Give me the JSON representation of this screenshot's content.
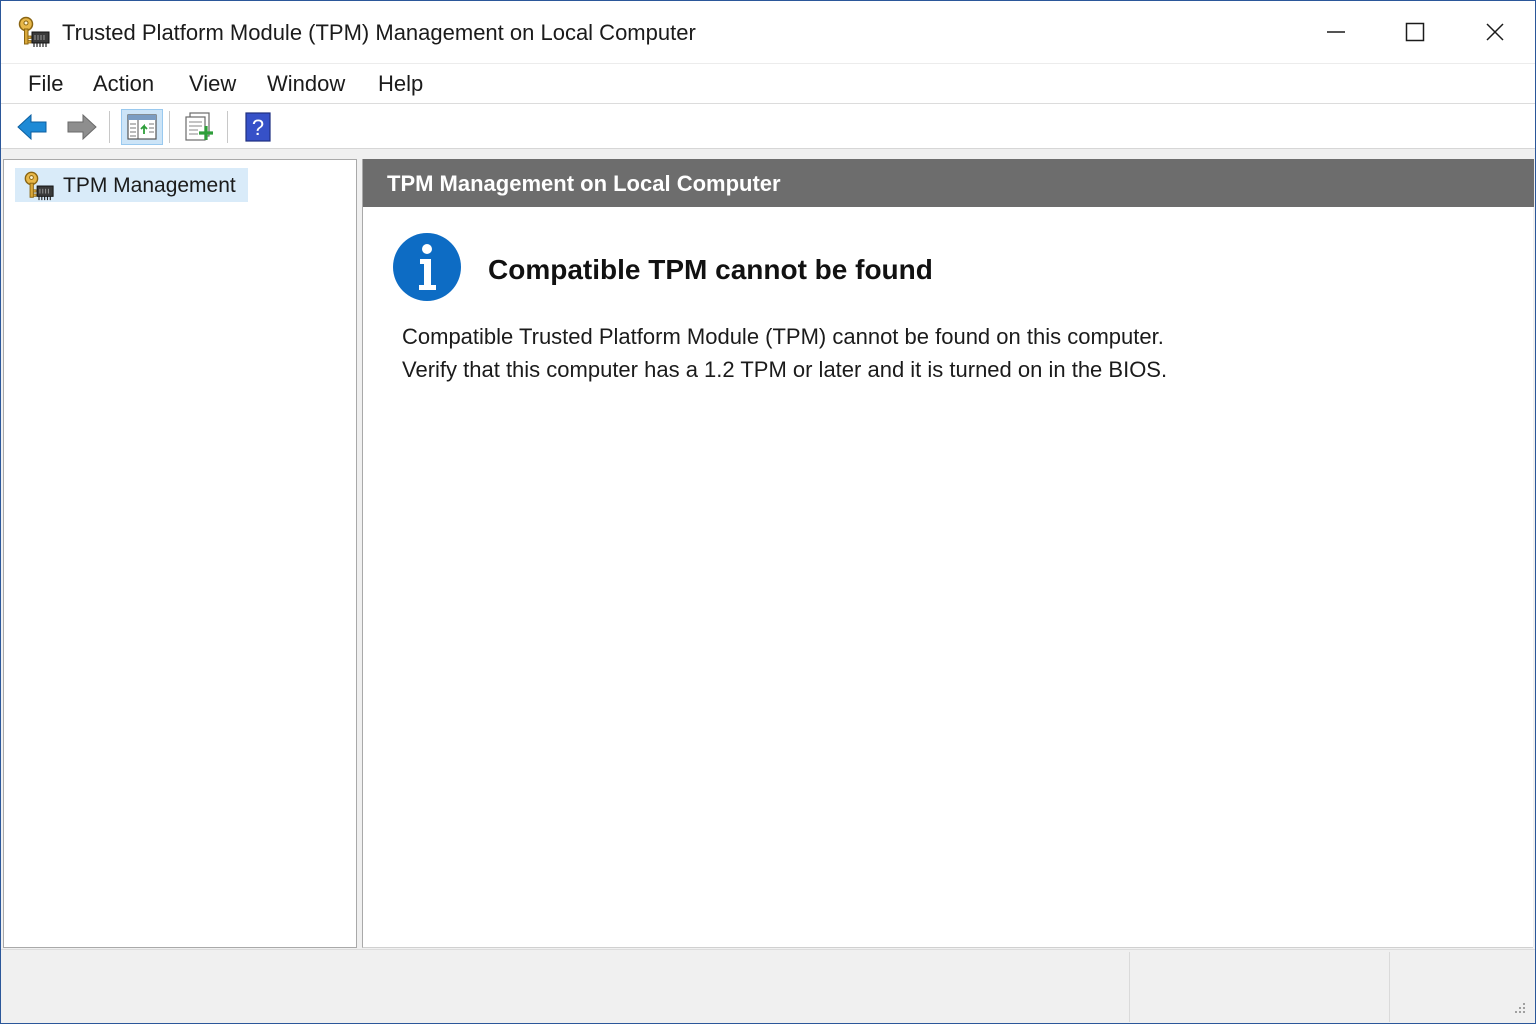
{
  "window": {
    "title": "Trusted Platform Module (TPM) Management on Local Computer"
  },
  "menu": {
    "items": [
      "File",
      "Action",
      "View",
      "Window",
      "Help"
    ]
  },
  "toolbar": {
    "buttons": [
      {
        "icon": "back-arrow-icon"
      },
      {
        "icon": "forward-arrow-icon"
      },
      {
        "icon": "show-hide-console-tree-icon",
        "pressed": true
      },
      {
        "icon": "export-list-icon"
      },
      {
        "icon": "help-icon"
      }
    ]
  },
  "tree": {
    "items": [
      {
        "label": "TPM Management",
        "selected": true,
        "icon": "tpm-key-chip-icon"
      }
    ]
  },
  "main": {
    "header": "TPM Management on Local Computer",
    "message": {
      "icon": "info-icon",
      "heading": "Compatible TPM cannot be found",
      "line1": "Compatible Trusted Platform Module (TPM) cannot be found on this computer.",
      "line2": "Verify that this computer has a 1.2 TPM or later and it is turned on in the BIOS."
    }
  },
  "colors": {
    "header_bg": "#6d6d6d",
    "info_blue": "#0d6cc4",
    "selection": "#d9ebf9",
    "window_border": "#2b579a"
  }
}
